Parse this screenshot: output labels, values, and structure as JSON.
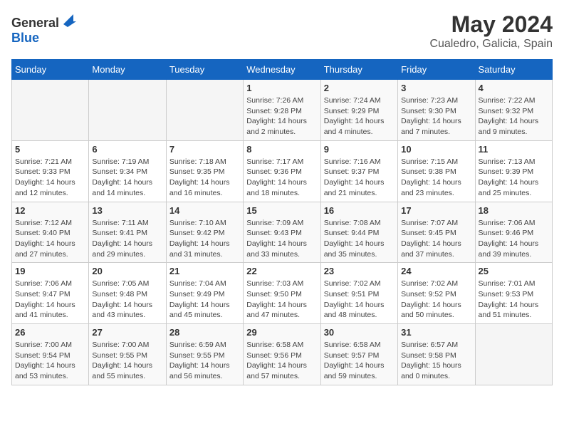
{
  "header": {
    "logo_line1": "General",
    "logo_line2": "Blue",
    "title": "May 2024",
    "subtitle": "Cualedro, Galicia, Spain"
  },
  "days_of_week": [
    "Sunday",
    "Monday",
    "Tuesday",
    "Wednesday",
    "Thursday",
    "Friday",
    "Saturday"
  ],
  "weeks": [
    [
      {
        "day": "",
        "info": ""
      },
      {
        "day": "",
        "info": ""
      },
      {
        "day": "",
        "info": ""
      },
      {
        "day": "1",
        "info": "Sunrise: 7:26 AM\nSunset: 9:28 PM\nDaylight: 14 hours\nand 2 minutes."
      },
      {
        "day": "2",
        "info": "Sunrise: 7:24 AM\nSunset: 9:29 PM\nDaylight: 14 hours\nand 4 minutes."
      },
      {
        "day": "3",
        "info": "Sunrise: 7:23 AM\nSunset: 9:30 PM\nDaylight: 14 hours\nand 7 minutes."
      },
      {
        "day": "4",
        "info": "Sunrise: 7:22 AM\nSunset: 9:32 PM\nDaylight: 14 hours\nand 9 minutes."
      }
    ],
    [
      {
        "day": "5",
        "info": "Sunrise: 7:21 AM\nSunset: 9:33 PM\nDaylight: 14 hours\nand 12 minutes."
      },
      {
        "day": "6",
        "info": "Sunrise: 7:19 AM\nSunset: 9:34 PM\nDaylight: 14 hours\nand 14 minutes."
      },
      {
        "day": "7",
        "info": "Sunrise: 7:18 AM\nSunset: 9:35 PM\nDaylight: 14 hours\nand 16 minutes."
      },
      {
        "day": "8",
        "info": "Sunrise: 7:17 AM\nSunset: 9:36 PM\nDaylight: 14 hours\nand 18 minutes."
      },
      {
        "day": "9",
        "info": "Sunrise: 7:16 AM\nSunset: 9:37 PM\nDaylight: 14 hours\nand 21 minutes."
      },
      {
        "day": "10",
        "info": "Sunrise: 7:15 AM\nSunset: 9:38 PM\nDaylight: 14 hours\nand 23 minutes."
      },
      {
        "day": "11",
        "info": "Sunrise: 7:13 AM\nSunset: 9:39 PM\nDaylight: 14 hours\nand 25 minutes."
      }
    ],
    [
      {
        "day": "12",
        "info": "Sunrise: 7:12 AM\nSunset: 9:40 PM\nDaylight: 14 hours\nand 27 minutes."
      },
      {
        "day": "13",
        "info": "Sunrise: 7:11 AM\nSunset: 9:41 PM\nDaylight: 14 hours\nand 29 minutes."
      },
      {
        "day": "14",
        "info": "Sunrise: 7:10 AM\nSunset: 9:42 PM\nDaylight: 14 hours\nand 31 minutes."
      },
      {
        "day": "15",
        "info": "Sunrise: 7:09 AM\nSunset: 9:43 PM\nDaylight: 14 hours\nand 33 minutes."
      },
      {
        "day": "16",
        "info": "Sunrise: 7:08 AM\nSunset: 9:44 PM\nDaylight: 14 hours\nand 35 minutes."
      },
      {
        "day": "17",
        "info": "Sunrise: 7:07 AM\nSunset: 9:45 PM\nDaylight: 14 hours\nand 37 minutes."
      },
      {
        "day": "18",
        "info": "Sunrise: 7:06 AM\nSunset: 9:46 PM\nDaylight: 14 hours\nand 39 minutes."
      }
    ],
    [
      {
        "day": "19",
        "info": "Sunrise: 7:06 AM\nSunset: 9:47 PM\nDaylight: 14 hours\nand 41 minutes."
      },
      {
        "day": "20",
        "info": "Sunrise: 7:05 AM\nSunset: 9:48 PM\nDaylight: 14 hours\nand 43 minutes."
      },
      {
        "day": "21",
        "info": "Sunrise: 7:04 AM\nSunset: 9:49 PM\nDaylight: 14 hours\nand 45 minutes."
      },
      {
        "day": "22",
        "info": "Sunrise: 7:03 AM\nSunset: 9:50 PM\nDaylight: 14 hours\nand 47 minutes."
      },
      {
        "day": "23",
        "info": "Sunrise: 7:02 AM\nSunset: 9:51 PM\nDaylight: 14 hours\nand 48 minutes."
      },
      {
        "day": "24",
        "info": "Sunrise: 7:02 AM\nSunset: 9:52 PM\nDaylight: 14 hours\nand 50 minutes."
      },
      {
        "day": "25",
        "info": "Sunrise: 7:01 AM\nSunset: 9:53 PM\nDaylight: 14 hours\nand 51 minutes."
      }
    ],
    [
      {
        "day": "26",
        "info": "Sunrise: 7:00 AM\nSunset: 9:54 PM\nDaylight: 14 hours\nand 53 minutes."
      },
      {
        "day": "27",
        "info": "Sunrise: 7:00 AM\nSunset: 9:55 PM\nDaylight: 14 hours\nand 55 minutes."
      },
      {
        "day": "28",
        "info": "Sunrise: 6:59 AM\nSunset: 9:55 PM\nDaylight: 14 hours\nand 56 minutes."
      },
      {
        "day": "29",
        "info": "Sunrise: 6:58 AM\nSunset: 9:56 PM\nDaylight: 14 hours\nand 57 minutes."
      },
      {
        "day": "30",
        "info": "Sunrise: 6:58 AM\nSunset: 9:57 PM\nDaylight: 14 hours\nand 59 minutes."
      },
      {
        "day": "31",
        "info": "Sunrise: 6:57 AM\nSunset: 9:58 PM\nDaylight: 15 hours\nand 0 minutes."
      },
      {
        "day": "",
        "info": ""
      }
    ]
  ]
}
